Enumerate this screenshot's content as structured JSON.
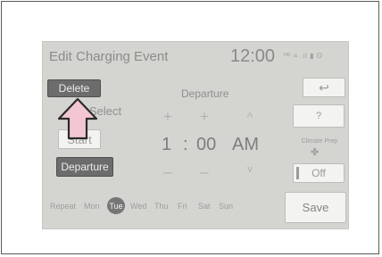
{
  "header": {
    "title": "Edit Charging Event",
    "clock": "12:00",
    "status_icons": "ᴴᴰ ≡ .ıl ▮ ʘ"
  },
  "left_panel": {
    "delete_label": "Delete",
    "select_label": "Select",
    "start_label": "Start",
    "departure_label": "Departure"
  },
  "time_setting": {
    "label": "Departure",
    "hour": "1",
    "separator": ":",
    "minute": "00",
    "ampm": "AM",
    "plus": "+",
    "minus": "–",
    "up": "^",
    "down": "v"
  },
  "right_panel": {
    "back_symbol": "↩",
    "help_label": "?",
    "climate_label": "Climate Prep",
    "fan_symbol": "✤",
    "climate_value": "Off"
  },
  "repeat": {
    "label": "Repeat",
    "days": [
      "Mon",
      "Tue",
      "Wed",
      "Thu",
      "Fri",
      "Sat",
      "Sun"
    ],
    "selected": "Tue"
  },
  "save_label": "Save",
  "colors": {
    "screen_bg": "#d4d4d0",
    "dark_button": "#6c6c6c",
    "arrow_fill": "#f4c6d3",
    "arrow_stroke": "#2b2b2b"
  }
}
